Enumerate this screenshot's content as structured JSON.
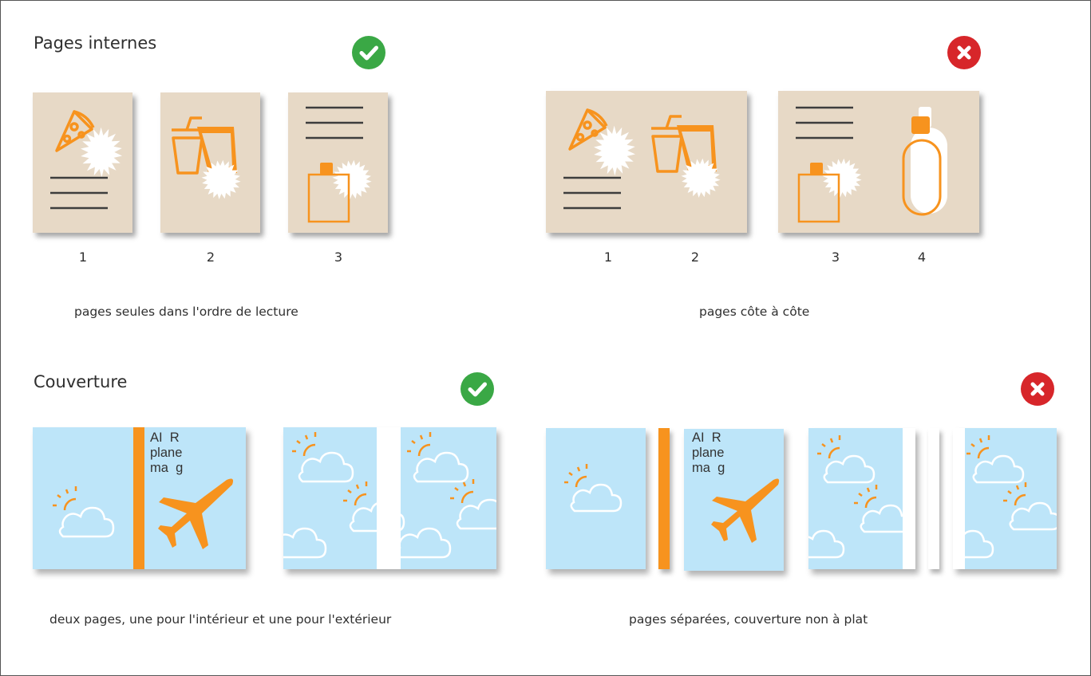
{
  "sections": {
    "inner": {
      "title": "Pages internes",
      "good": {
        "page_numbers": [
          "1",
          "2",
          "3"
        ],
        "caption": "pages seules dans l'ordre de lecture",
        "badge": "check-icon"
      },
      "bad": {
        "page_numbers": [
          "1",
          "2",
          "3",
          "4"
        ],
        "caption": "pages côte à côte",
        "badge": "cross-icon"
      }
    },
    "cover": {
      "title": "Couverture",
      "good": {
        "caption": "deux pages, une pour l'intérieur et une pour l'extérieur",
        "badge": "check-icon"
      },
      "bad": {
        "caption": "pages séparées, couverture non à plat",
        "badge": "cross-icon"
      },
      "cover_text": "AI  R\nplane\nma  g"
    }
  },
  "colors": {
    "check": "#3aa845",
    "cross": "#d7262a",
    "page": "#e7d9c6",
    "cover": "#bde5f9",
    "accent": "#f7931e"
  }
}
